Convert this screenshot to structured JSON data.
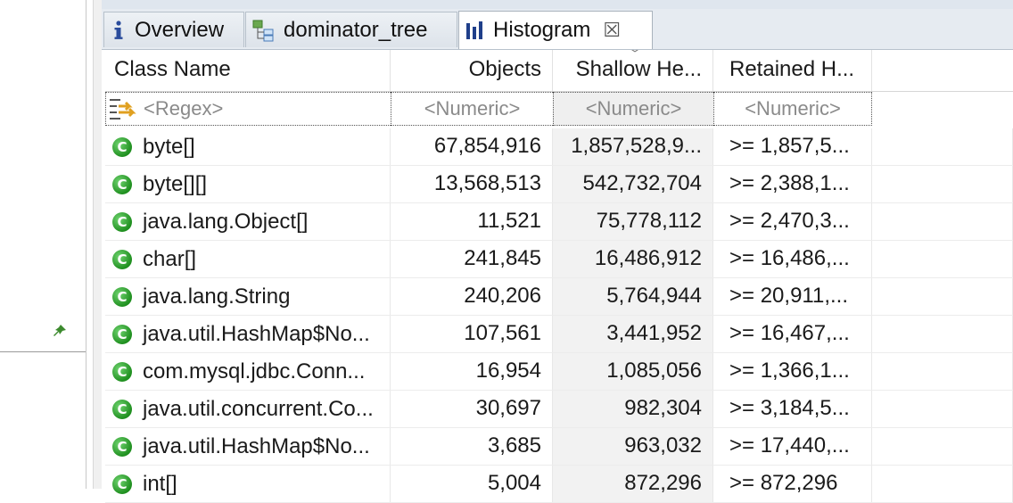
{
  "tabs": [
    {
      "label": "Overview",
      "icon": "info-icon"
    },
    {
      "label": "dominator_tree",
      "icon": "tree-icon"
    },
    {
      "label": "Histogram",
      "icon": "histogram-icon",
      "close": "☒"
    }
  ],
  "columns": [
    "Class Name",
    "Objects",
    "Shallow He...",
    "Retained H..."
  ],
  "filters": {
    "regex_placeholder": "<Regex>",
    "numeric_placeholder": "<Numeric>"
  },
  "rows": [
    {
      "name": "byte[]",
      "objects": "67,854,916",
      "shallow": "1,857,528,9...",
      "retained": ">= 1,857,5..."
    },
    {
      "name": "byte[][]",
      "objects": "13,568,513",
      "shallow": "542,732,704",
      "retained": ">= 2,388,1..."
    },
    {
      "name": "java.lang.Object[]",
      "objects": "11,521",
      "shallow": "75,778,112",
      "retained": ">= 2,470,3..."
    },
    {
      "name": "char[]",
      "objects": "241,845",
      "shallow": "16,486,912",
      "retained": ">= 16,486,..."
    },
    {
      "name": "java.lang.String",
      "objects": "240,206",
      "shallow": "5,764,944",
      "retained": ">= 20,911,..."
    },
    {
      "name": "java.util.HashMap$No...",
      "objects": "107,561",
      "shallow": "3,441,952",
      "retained": ">= 16,467,..."
    },
    {
      "name": "com.mysql.jdbc.Conn...",
      "objects": "16,954",
      "shallow": "1,085,056",
      "retained": ">= 1,366,1..."
    },
    {
      "name": "java.util.concurrent.Co...",
      "objects": "30,697",
      "shallow": "982,304",
      "retained": ">= 3,184,5..."
    },
    {
      "name": "java.util.HashMap$No...",
      "objects": "3,685",
      "shallow": "963,032",
      "retained": ">= 17,440,..."
    },
    {
      "name": "int[]",
      "objects": "5,004",
      "shallow": "872,296",
      "retained": ">= 872,296"
    }
  ],
  "class_icon_letter": "C",
  "colors": {
    "class_icon": "#2e9e2e",
    "tab_bg": "#e6ebf1",
    "shallow_col_bg": "#f2f2f2"
  }
}
